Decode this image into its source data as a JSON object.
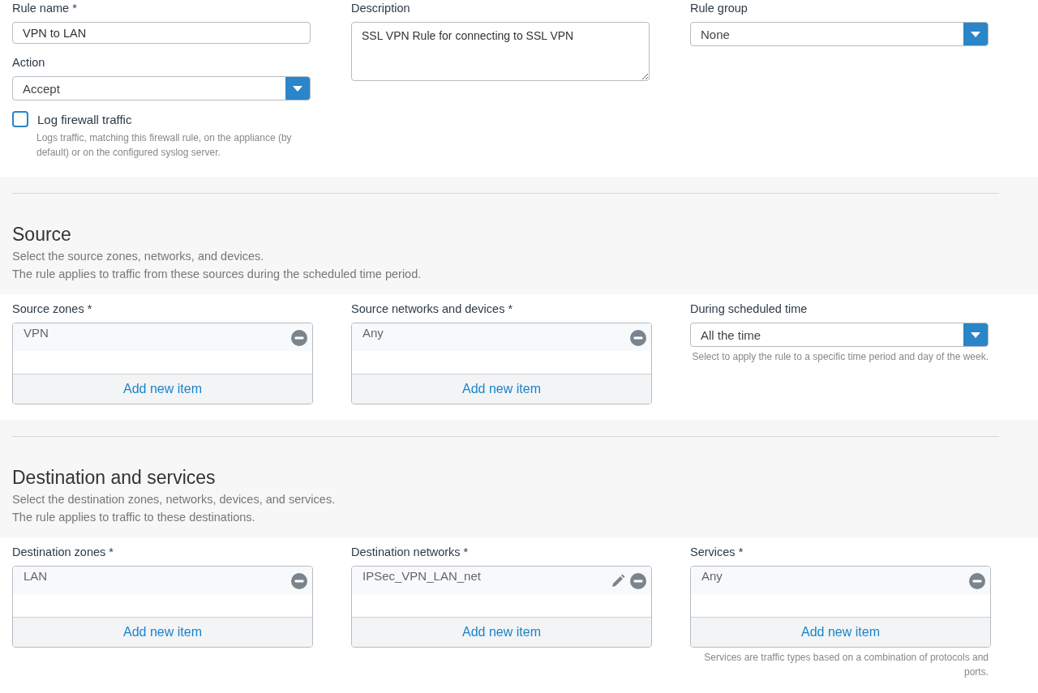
{
  "general": {
    "rule_name": {
      "label": "Rule name *",
      "value": "VPN to LAN"
    },
    "description": {
      "label": "Description",
      "value": "SSL VPN Rule for connecting to SSL VPN"
    },
    "rule_group": {
      "label": "Rule group",
      "value": "None"
    },
    "action": {
      "label": "Action",
      "value": "Accept"
    },
    "log_traffic": {
      "label": "Log firewall traffic",
      "checked": false,
      "hint": "Logs traffic, matching this firewall rule, on the appliance (by default) or on the configured syslog server."
    }
  },
  "sections": [
    {
      "title": "Source",
      "lines": [
        "Select the source zones, networks, and devices.",
        "The rule applies to traffic from these sources during the scheduled time period."
      ],
      "fields": [
        {
          "kind": "list",
          "label": "Source zones *",
          "items": [
            {
              "name": "VPN",
              "editable": false
            }
          ],
          "add_label": "Add new item"
        },
        {
          "kind": "list",
          "label": "Source networks and devices *",
          "items": [
            {
              "name": "Any",
              "editable": false
            }
          ],
          "add_label": "Add new item"
        },
        {
          "kind": "select",
          "label": "During scheduled time",
          "value": "All the time",
          "hint": "Select to apply the rule to a specific time period and day of the week."
        }
      ]
    },
    {
      "title": "Destination and services",
      "lines": [
        "Select the destination zones, networks, devices, and services.",
        "The rule applies to traffic to these destinations."
      ],
      "fields": [
        {
          "kind": "list",
          "label": "Destination zones *",
          "items": [
            {
              "name": "LAN",
              "editable": false
            }
          ],
          "add_label": "Add new item"
        },
        {
          "kind": "list",
          "label": "Destination networks *",
          "items": [
            {
              "name": "IPSec_VPN_LAN_net",
              "editable": true
            }
          ],
          "add_label": "Add new item"
        },
        {
          "kind": "list",
          "label": "Services *",
          "items": [
            {
              "name": "Any",
              "editable": false
            }
          ],
          "add_label": "Add new item",
          "hint": "Services are traffic types based on a combination of protocols and ports."
        }
      ]
    }
  ]
}
